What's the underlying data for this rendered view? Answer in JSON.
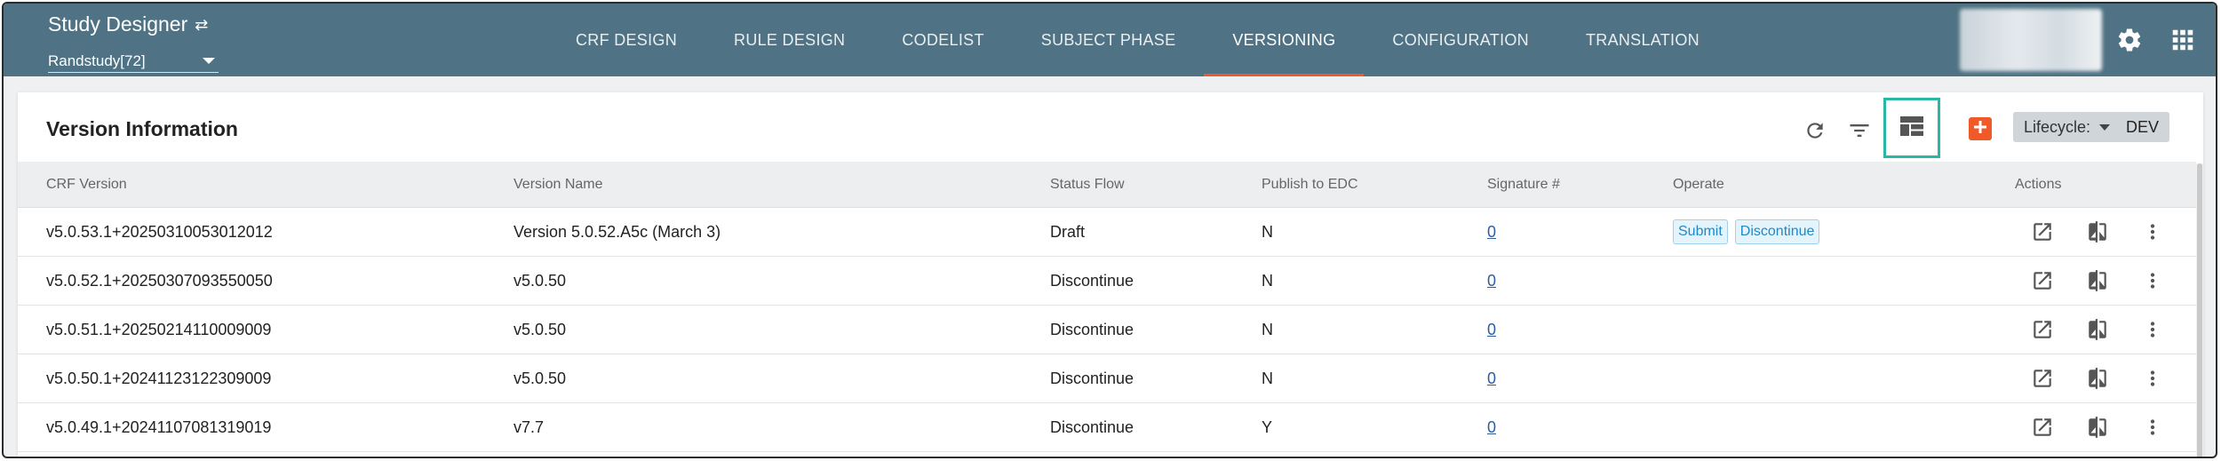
{
  "header": {
    "app_title": "Study Designer",
    "study_select_value": "Randstudy[72]",
    "nav_tabs": [
      {
        "label": "CRF DESIGN",
        "active": false
      },
      {
        "label": "RULE DESIGN",
        "active": false
      },
      {
        "label": "CODELIST",
        "active": false
      },
      {
        "label": "SUBJECT PHASE",
        "active": false
      },
      {
        "label": "VERSIONING",
        "active": true
      },
      {
        "label": "CONFIGURATION",
        "active": false
      },
      {
        "label": "TRANSLATION",
        "active": false
      }
    ],
    "icons": [
      "swap-icon",
      "gear-icon",
      "apps-grid-icon"
    ]
  },
  "card": {
    "title": "Version Information",
    "toolbar_icons": [
      "refresh-icon",
      "filter-icon",
      "layout-icon",
      "add-icon"
    ],
    "lifecycle_label": "Lifecycle:",
    "lifecycle_value": "DEV"
  },
  "table": {
    "columns": [
      "CRF Version",
      "Version Name",
      "Status Flow",
      "Publish to EDC",
      "Signature #",
      "Operate",
      "Actions"
    ],
    "rows": [
      {
        "crf_version": "v5.0.53.1+20250310053012012",
        "version_name": "Version 5.0.52.A5c (March 3)",
        "status": "Draft",
        "publish": "N",
        "signature": "0",
        "operate": [
          "Submit",
          "Discontinue"
        ]
      },
      {
        "crf_version": "v5.0.52.1+20250307093550050",
        "version_name": "v5.0.50",
        "status": "Discontinue",
        "publish": "N",
        "signature": "0",
        "operate": []
      },
      {
        "crf_version": "v5.0.51.1+20250214110009009",
        "version_name": "v5.0.50",
        "status": "Discontinue",
        "publish": "N",
        "signature": "0",
        "operate": []
      },
      {
        "crf_version": "v5.0.50.1+20241123122309009",
        "version_name": "v5.0.50",
        "status": "Discontinue",
        "publish": "N",
        "signature": "0",
        "operate": []
      },
      {
        "crf_version": "v5.0.49.1+20241107081319019",
        "version_name": "v7.7",
        "status": "Discontinue",
        "publish": "Y",
        "signature": "0",
        "operate": []
      }
    ],
    "row_actions": [
      "open-external-icon",
      "compare-icon",
      "more-vert-icon"
    ]
  },
  "colors": {
    "topbar": "#4f7384",
    "active_tab_underline": "#ee5a2a",
    "add_button": "#f05a28",
    "highlight_border": "#2bb7a6",
    "link": "#2b5ca8"
  }
}
